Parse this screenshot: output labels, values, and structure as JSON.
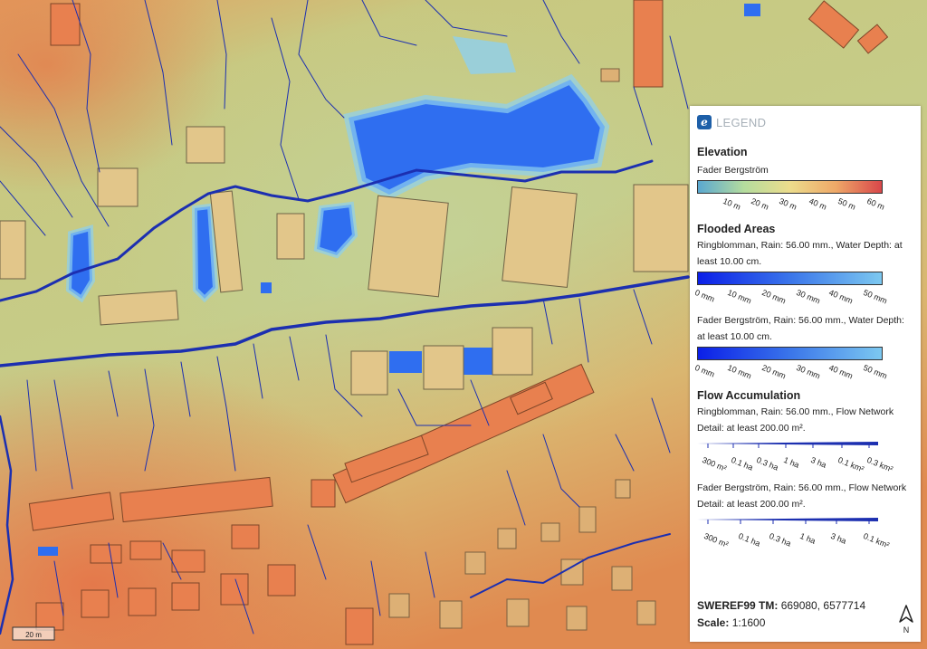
{
  "legend": {
    "title": "LEGEND",
    "logo_letter": "e",
    "elevation": {
      "heading": "Elevation",
      "layer": "Fader Bergström",
      "ticks": [
        "10 m",
        "20 m",
        "30 m",
        "40 m",
        "50 m",
        "60 m"
      ]
    },
    "flooded": {
      "heading": "Flooded Areas",
      "layer1": "Ringblomman, Rain: 56.00 mm., Water Depth: at least 10.00 cm.",
      "layer2": "Fader Bergström, Rain: 56.00 mm., Water Depth: at least 10.00 cm.",
      "ticks": [
        "0 mm",
        "10 mm",
        "20 mm",
        "30 mm",
        "40 mm",
        "50 mm"
      ]
    },
    "flow": {
      "heading": "Flow Accumulation",
      "layer1": "Ringblomman, Rain: 56.00 mm., Flow Network Detail: at least 200.00 m².",
      "ticks1": [
        "300 m²",
        "0.1 ha",
        "0.3 ha",
        "1 ha",
        "3 ha",
        "0.1 km²",
        "0.3 km²"
      ],
      "layer2": "Fader Bergström, Rain: 56.00 mm., Flow Network Detail: at least 200.00 m².",
      "ticks2": [
        "300 m²",
        "0.1 ha",
        "0.3 ha",
        "1 ha",
        "3 ha",
        "0.1 km²"
      ]
    },
    "crs_label": "SWEREF99 TM:",
    "crs_value": "669080, 6577714",
    "scale_label": "Scale:",
    "scale_value": "1:1600",
    "north": "N"
  },
  "scalebar": "20 m",
  "colors": {
    "building_low": "#e2c68a",
    "building_high": "#e8804f",
    "flood": "#2f6ef0",
    "flood_light": "#7cc8e8",
    "stream": "#1c2fb0"
  }
}
